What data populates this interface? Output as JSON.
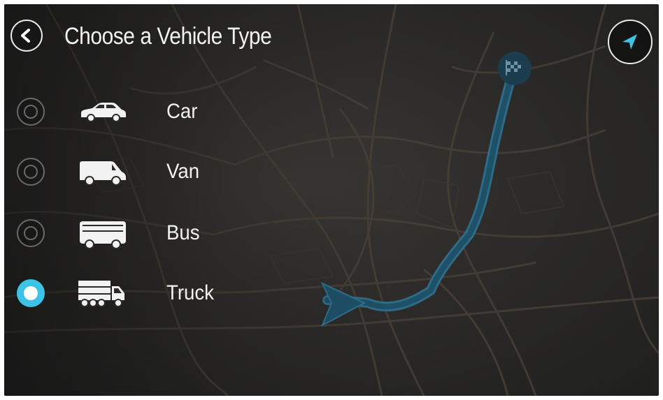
{
  "header": {
    "title": "Choose a Vehicle Type",
    "back_icon": "back-arrow-icon",
    "locate_icon": "navigation-arrow-icon"
  },
  "vehicle_options": [
    {
      "label": "Car",
      "icon": "car-icon",
      "selected": false
    },
    {
      "label": "Van",
      "icon": "van-icon",
      "selected": false
    },
    {
      "label": "Bus",
      "icon": "bus-icon",
      "selected": false
    },
    {
      "label": "Truck",
      "icon": "truck-icon",
      "selected": true
    }
  ],
  "map": {
    "destination_icon": "checkered-flag-icon",
    "current_position_icon": "position-arrow-icon"
  },
  "colors": {
    "accent": "#3cc3e6",
    "route": "#1e5068",
    "route_edge": "#2f7290",
    "text": "#f2f2f2",
    "map_background": "#2c2b29",
    "map_roads": "#4a4238"
  }
}
